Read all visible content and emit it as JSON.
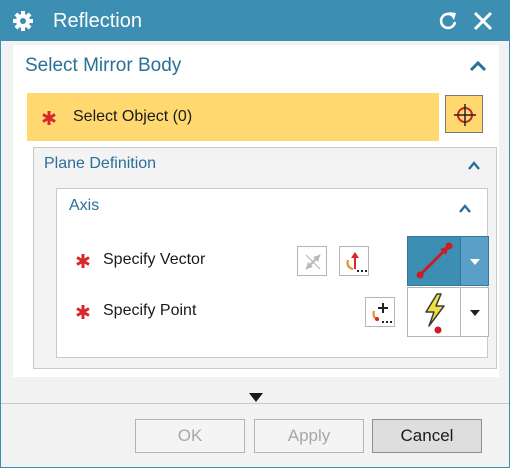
{
  "window": {
    "title": "Reflection",
    "icons": {
      "app": "gear-icon",
      "reset": "reset-icon",
      "close": "close-icon"
    }
  },
  "section": {
    "title": "Select Mirror Body",
    "select_object_label": "Select Object (0)",
    "select_icon": "crosshair-icon"
  },
  "plane_definition": {
    "title": "Plane Definition",
    "axis": {
      "title": "Axis",
      "specify_vector_label": "Specify Vector",
      "specify_point_label": "Specify Point",
      "vector_icons": [
        "reverse-direction-icon",
        "vector-constructor-icon",
        "inferred-vector-icon"
      ],
      "point_icons": [
        "point-constructor-icon",
        "inferred-point-icon"
      ]
    }
  },
  "footer": {
    "ok_label": "OK",
    "apply_label": "Apply",
    "cancel_label": "Cancel"
  },
  "colors": {
    "accent": "#3c8fb2",
    "required_star": "#d9262c",
    "selection_highlight": "#ffd970",
    "header_text": "#2a6f98"
  }
}
